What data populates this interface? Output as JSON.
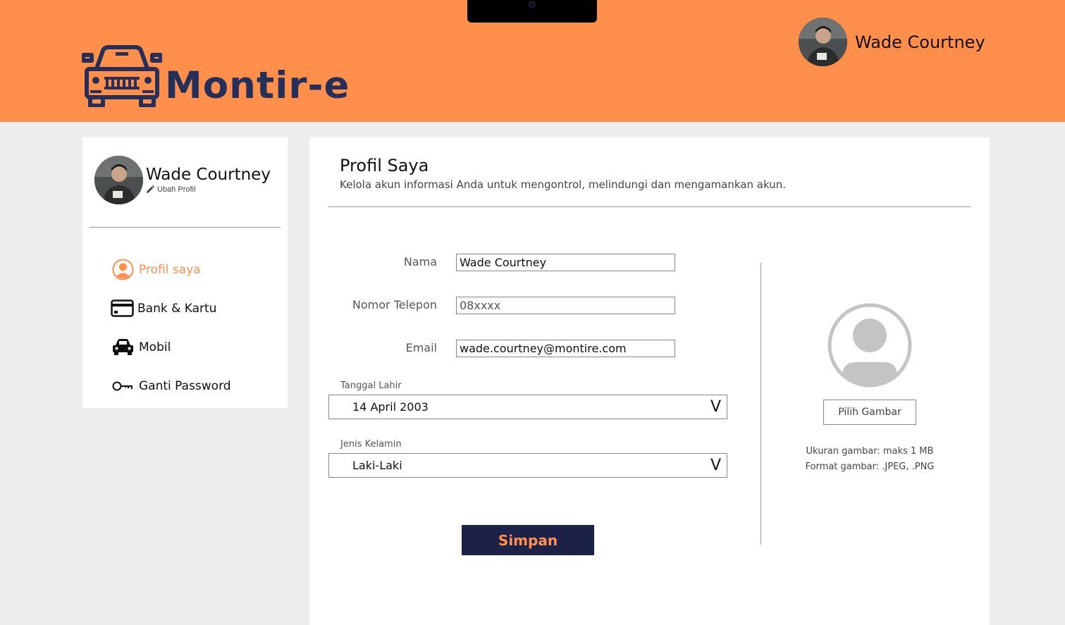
{
  "header": {
    "brand": "Montir-e",
    "user_name": "Wade Courtney"
  },
  "sidebar": {
    "user_name": "Wade Courtney",
    "edit_label": "Ubah Profil",
    "items": [
      {
        "label": "Profil saya",
        "icon": "user-circle-icon",
        "active": true
      },
      {
        "label": "Bank & Kartu",
        "icon": "credit-card-icon",
        "active": false
      },
      {
        "label": "Mobil",
        "icon": "car-icon",
        "active": false
      },
      {
        "label": "Ganti Password",
        "icon": "key-icon",
        "active": false
      }
    ]
  },
  "main": {
    "title": "Profil Saya",
    "subtitle": "Kelola akun informasi Anda untuk mengontrol, melindungi dan mengamankan akun.",
    "fields": {
      "nama": {
        "label": "Nama",
        "value": "Wade Courtney"
      },
      "telepon": {
        "label": "Nomor Telepon",
        "value": "08xxxx"
      },
      "email": {
        "label": "Email",
        "value": "wade.courtney@montire.com"
      }
    },
    "birth": {
      "label": "Tanggal Lahir",
      "value": "14 April 2003",
      "chevron": "V"
    },
    "gender": {
      "label": "Jenis Kelamin",
      "value": "Laki-Laki",
      "chevron": "V"
    },
    "save_label": "Simpan",
    "picture": {
      "button_label": "Pilih Gambar",
      "size_note": "Ukuran gambar:  maks 1 MB",
      "format_note": "Format gambar:  .JPEG, .PNG"
    }
  },
  "colors": {
    "accent": "#ff8f4b",
    "navy": "#1c2148",
    "brand_text": "#24305a",
    "background": "#eeeeee"
  }
}
